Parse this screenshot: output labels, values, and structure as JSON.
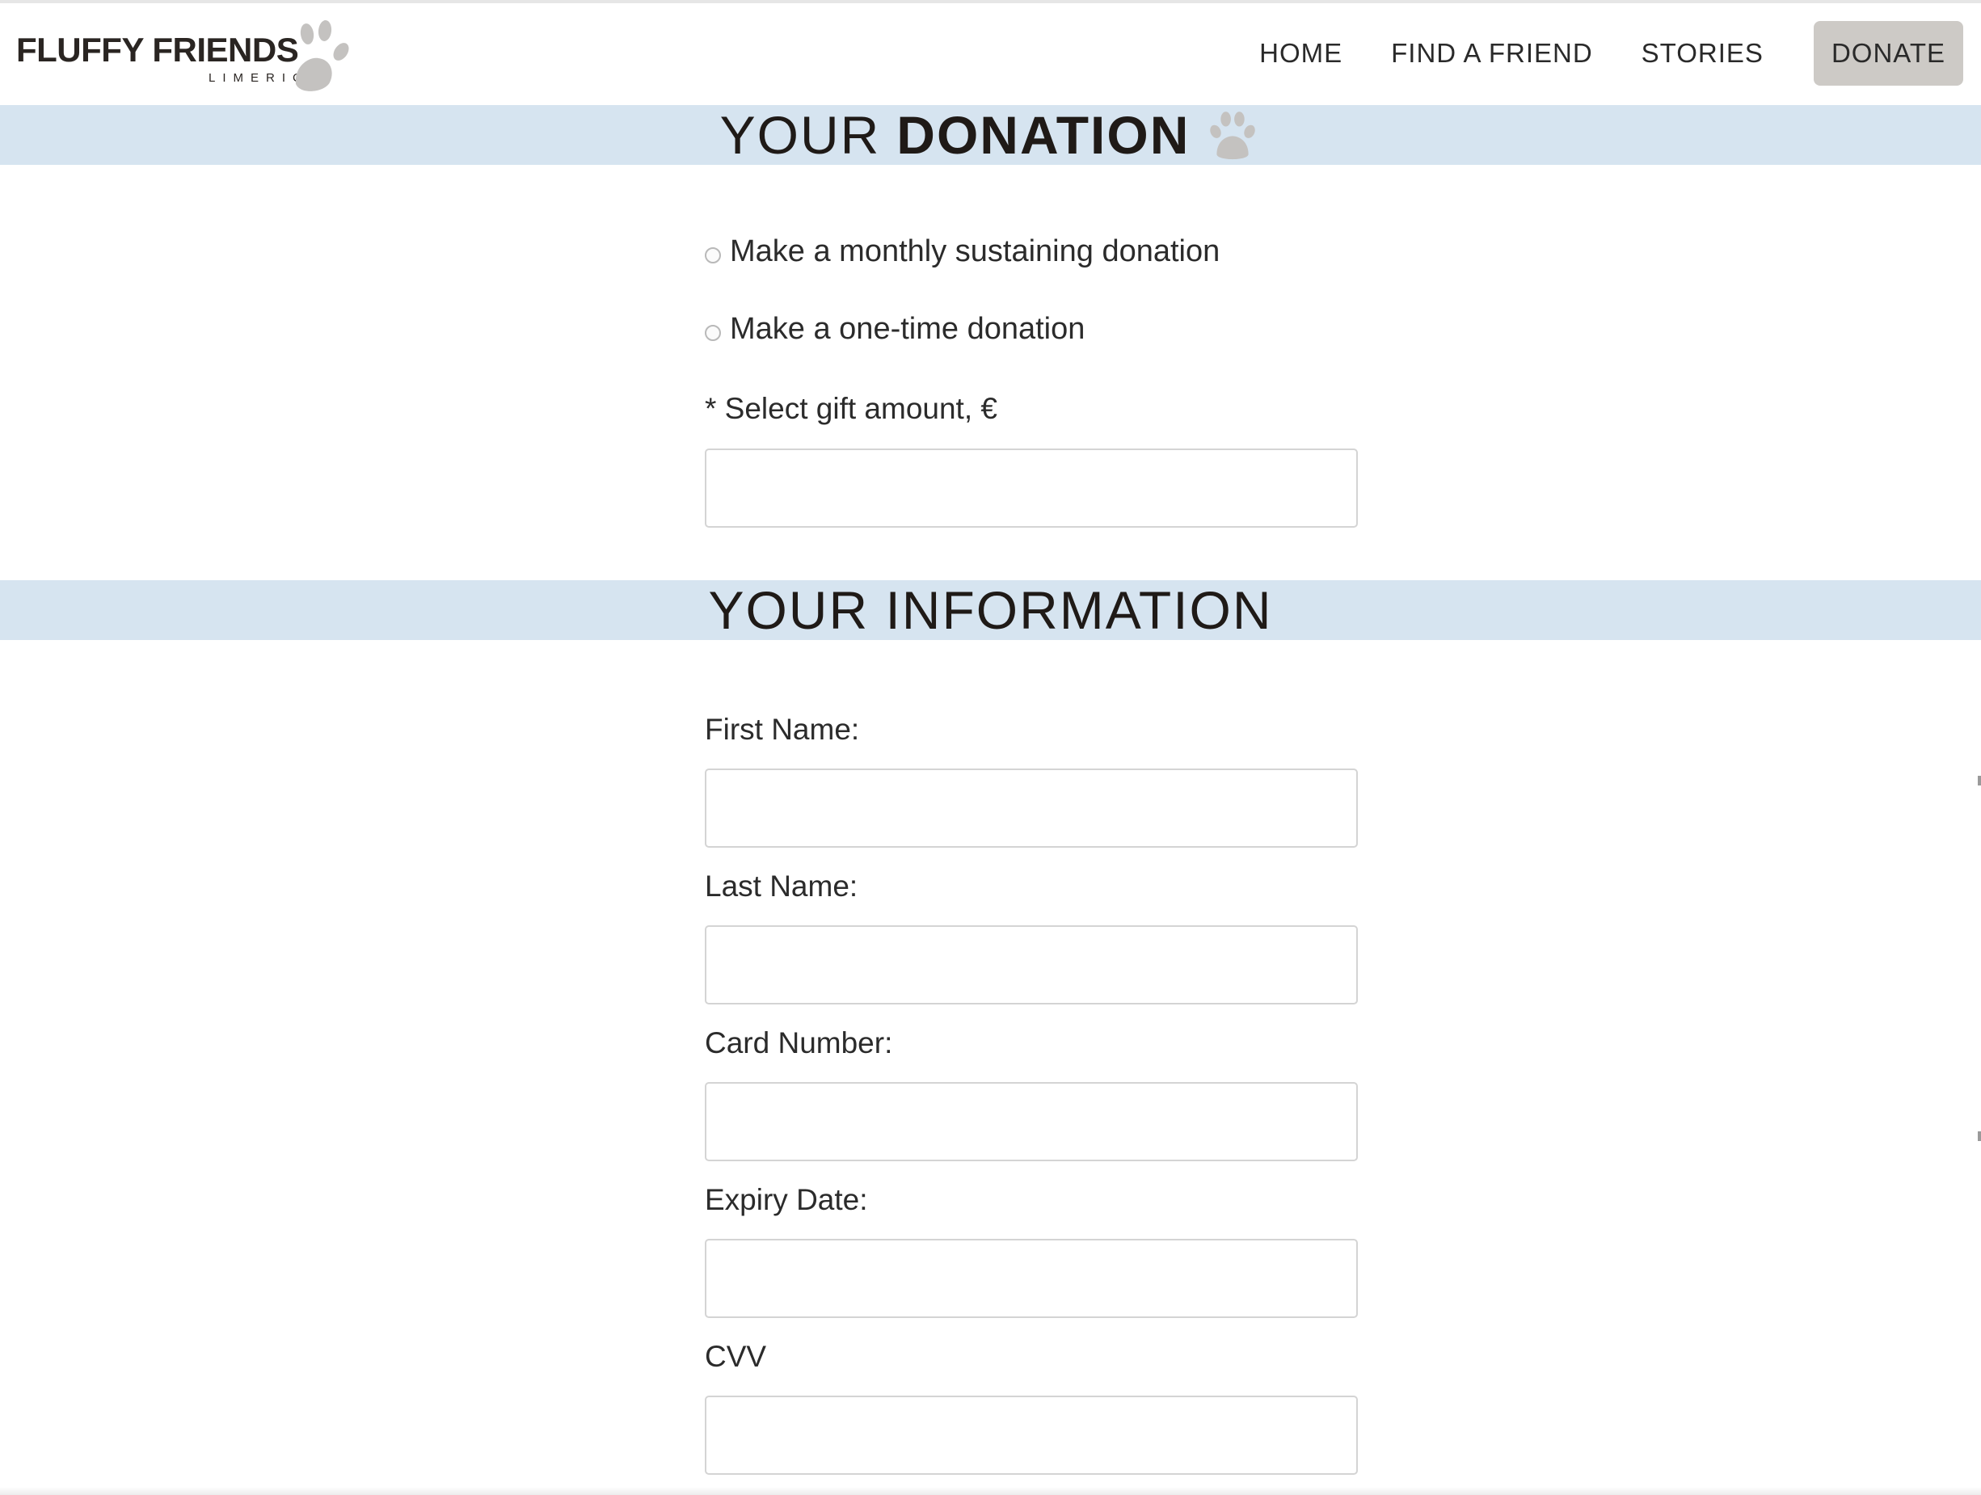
{
  "header": {
    "logo": {
      "name": "FLUFFY FRIENDS",
      "subtitle": "LIMERICK",
      "icon": "paw-icon"
    },
    "nav": {
      "home": "HOME",
      "find_a_friend": "FIND A FRIEND",
      "stories": "STORIES",
      "donate": "DONATE"
    }
  },
  "donation_section": {
    "title_light": "YOUR",
    "title_bold": "DONATION",
    "icon": "paw-icon",
    "options": [
      {
        "label": "Make a monthly sustaining donation",
        "selected": false
      },
      {
        "label": "Make a one-time donation",
        "selected": false
      }
    ],
    "amount": {
      "label": "* Select gift amount, €",
      "value": ""
    }
  },
  "information_section": {
    "title": "YOUR INFORMATION",
    "fields": [
      {
        "label": "First Name:",
        "value": ""
      },
      {
        "label": "Last Name:",
        "value": ""
      },
      {
        "label": "Card Number:",
        "value": ""
      },
      {
        "label": "Expiry Date:",
        "value": ""
      },
      {
        "label": "CVV",
        "value": ""
      }
    ]
  },
  "colors": {
    "banner_background": "#d6e4f0",
    "donate_button": "#cdcac6",
    "paw_gray": "#c4c2c0",
    "text_dark": "#2a2522"
  }
}
